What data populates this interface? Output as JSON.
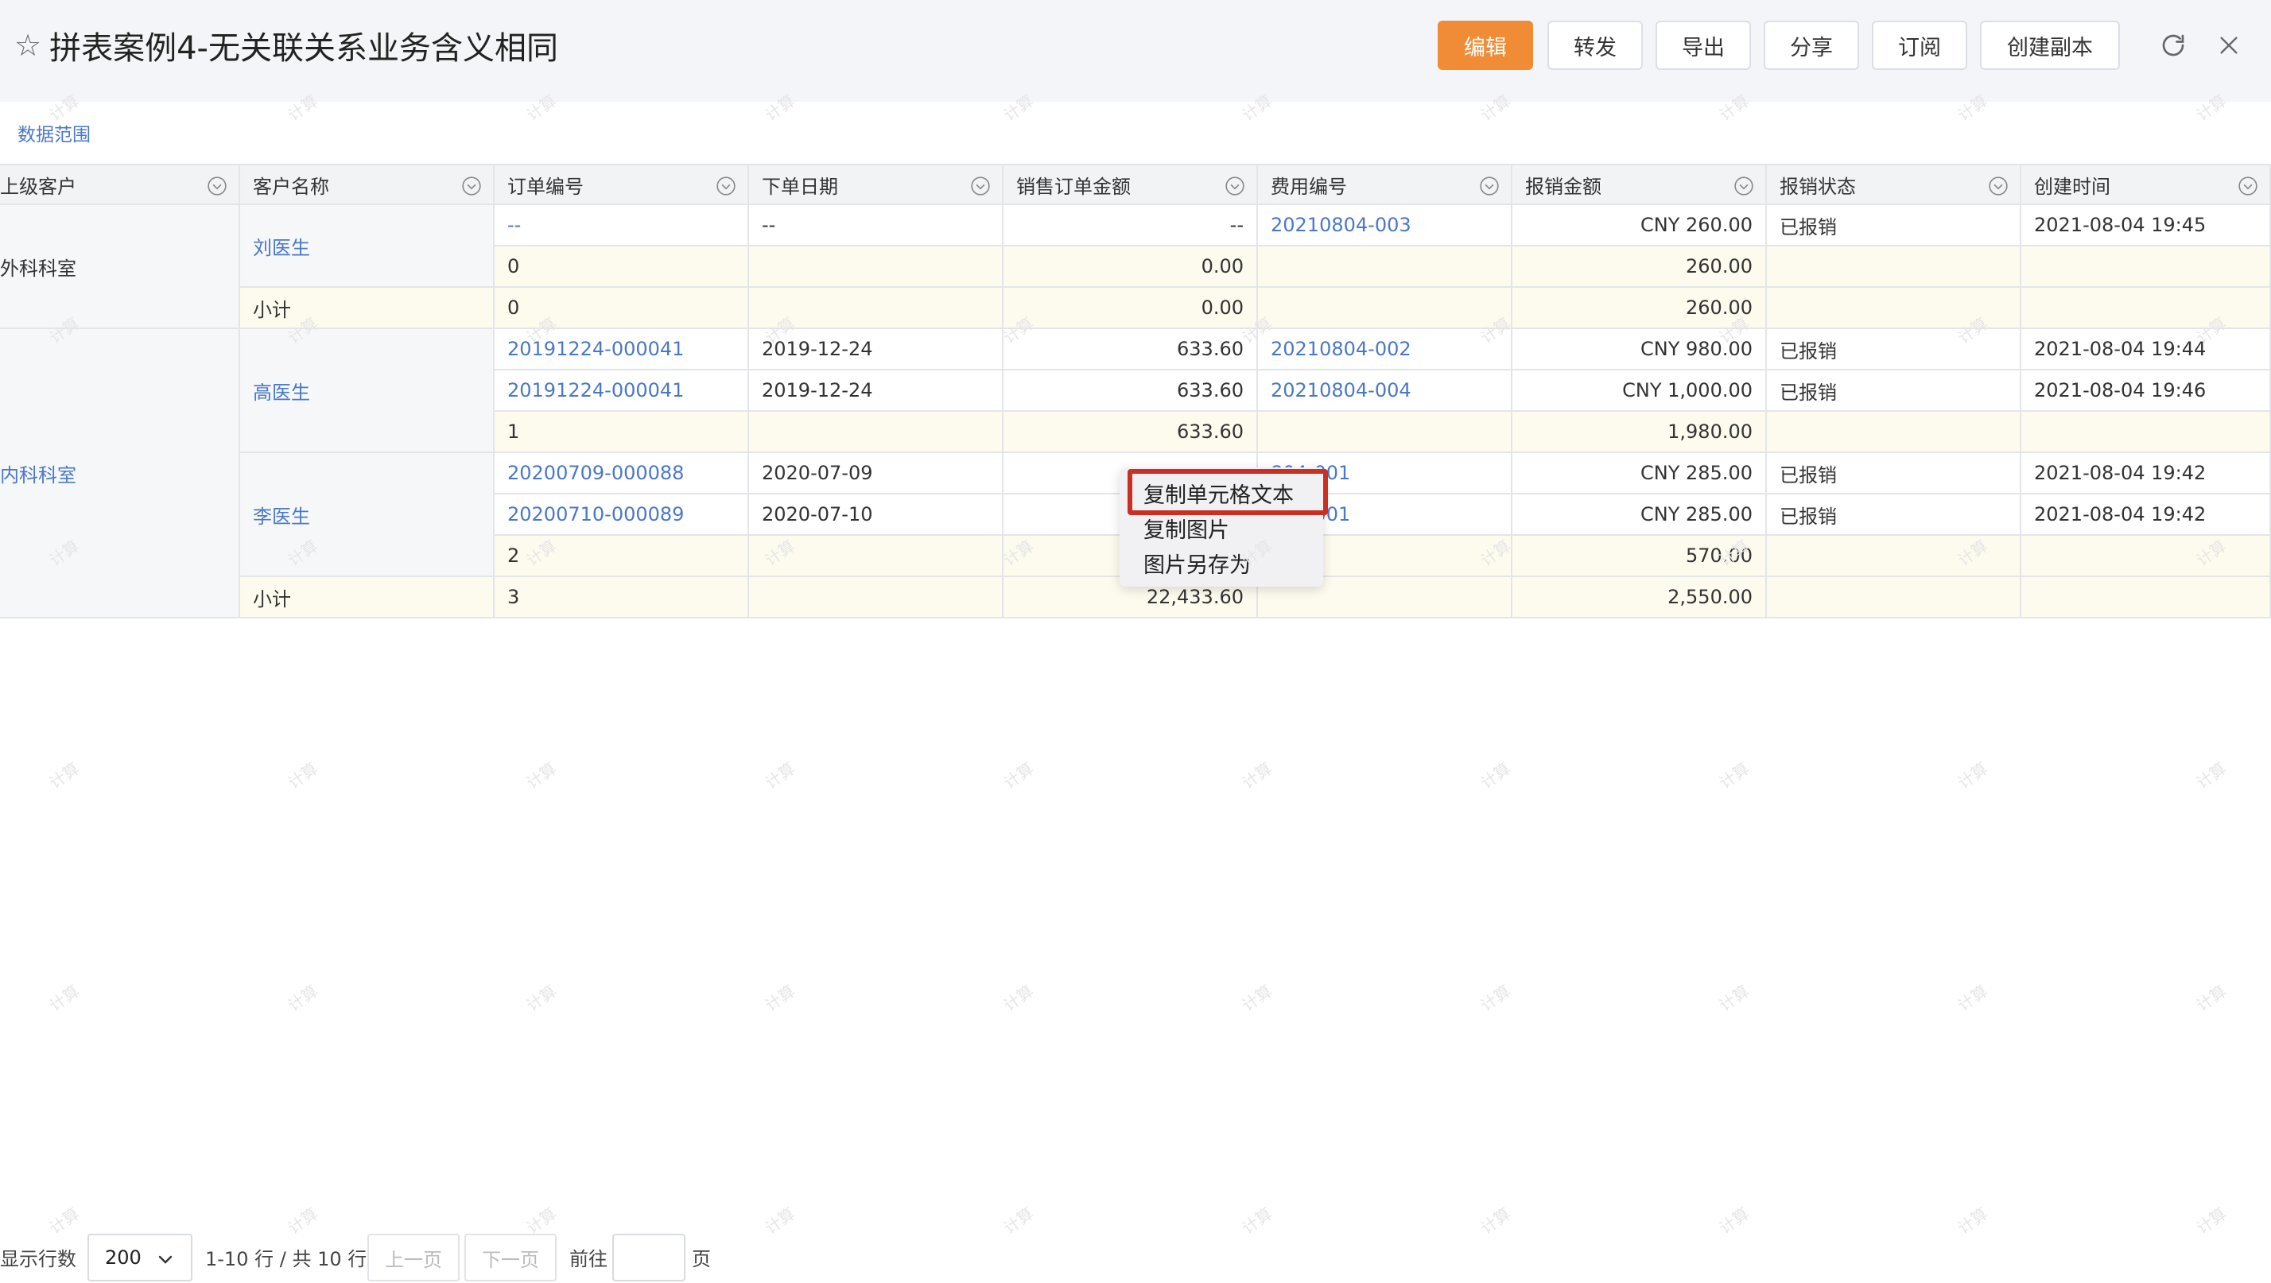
{
  "header": {
    "title": "拼表案例4-无关联关系业务含义相同",
    "buttons": {
      "edit": "编辑",
      "forward": "转发",
      "export": "导出",
      "share": "分享",
      "subscribe": "订阅",
      "copy": "创建副本"
    }
  },
  "data_range": "数据范围",
  "columns": [
    "上级客户",
    "客户名称",
    "订单编号",
    "下单日期",
    "销售订单金额",
    "费用编号",
    "报销金额",
    "报销状态",
    "创建时间"
  ],
  "groups": [
    {
      "name": "外科科室",
      "link": false
    },
    {
      "name": "内科科室",
      "link": true
    }
  ],
  "customers": [
    {
      "name": "刘医生"
    },
    {
      "name": "高医生"
    },
    {
      "name": "李医生"
    }
  ],
  "subtotal_label": "小计",
  "rows": [
    [
      "--",
      "--",
      "--",
      "20210804-003",
      "CNY 260.00",
      "已报销",
      "2021-08-04 19:45"
    ],
    [
      "0",
      "",
      "0.00",
      "",
      "260.00",
      "",
      ""
    ],
    [
      "20191224-000041",
      "2019-12-24",
      "633.60",
      "20210804-002",
      "CNY 980.00",
      "已报销",
      "2021-08-04 19:44"
    ],
    [
      "20191224-000041",
      "2019-12-24",
      "633.60",
      "20210804-004",
      "CNY 1,000.00",
      "已报销",
      "2021-08-04 19:46"
    ],
    [
      "1",
      "",
      "633.60",
      "",
      "1,980.00",
      "",
      ""
    ],
    [
      "20200709-000088",
      "2020-07-09",
      "",
      "804-001",
      "CNY 285.00",
      "已报销",
      "2021-08-04 19:42"
    ],
    [
      "20200710-000089",
      "2020-07-10",
      "",
      "804-001",
      "CNY 285.00",
      "已报销",
      "2021-08-04 19:42"
    ],
    [
      "2",
      "",
      "",
      "",
      "570.00",
      "",
      ""
    ]
  ],
  "subtotals": [
    [
      "0",
      "",
      "0.00",
      "",
      "260.00",
      "",
      ""
    ],
    [
      "3",
      "",
      "22,433.60",
      "",
      "2,550.00",
      "",
      ""
    ]
  ],
  "context_menu": [
    "复制单元格文本",
    "复制图片",
    "图片另存为"
  ],
  "pager": {
    "rows_label": "显示行数",
    "page_size": "200",
    "range_text": "1-10 行 / 共 10 行",
    "prev": "上一页",
    "next": "下一页",
    "goto": "前往",
    "page_unit": "页"
  },
  "watermark_text": "计算"
}
